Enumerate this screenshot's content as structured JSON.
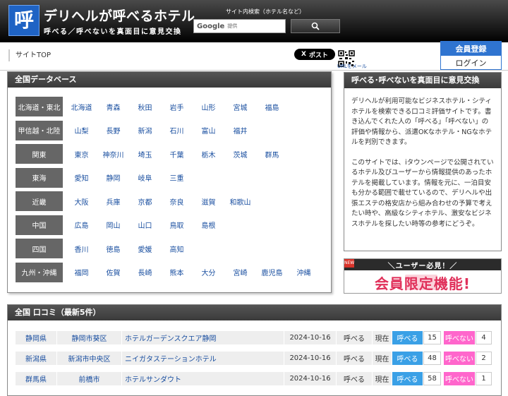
{
  "header": {
    "logo_char": "呼",
    "title": "デリヘルが呼べるホテル",
    "subtitle": "呼べる／呼べないを真面目に意見交換",
    "search_caption": "サイト内検索（ホテル名など）",
    "search_brand": "Google",
    "search_provided": "提供",
    "search_button_icon": "search-icon"
  },
  "subbar": {
    "breadcrumb": "サイトTOP",
    "post_label": "ポスト",
    "post_prefix": "X",
    "url_link": "URLをメール",
    "register_label": "会員登録",
    "login_label": "ログイン"
  },
  "database": {
    "title": "全国データベース",
    "regions": [
      {
        "label": "北海道・東北",
        "prefs": [
          "北海道",
          "青森",
          "秋田",
          "岩手",
          "山形",
          "宮城",
          "福島"
        ]
      },
      {
        "label": "甲信越・北陸",
        "prefs": [
          "山梨",
          "長野",
          "新潟",
          "石川",
          "富山",
          "福井"
        ]
      },
      {
        "label": "関東",
        "prefs": [
          "東京",
          "神奈川",
          "埼玉",
          "千葉",
          "栃木",
          "茨城",
          "群馬"
        ]
      },
      {
        "label": "東海",
        "prefs": [
          "愛知",
          "静岡",
          "岐阜",
          "三重"
        ]
      },
      {
        "label": "近畿",
        "prefs": [
          "大阪",
          "兵庫",
          "京都",
          "奈良",
          "滋賀",
          "和歌山"
        ]
      },
      {
        "label": "中国",
        "prefs": [
          "広島",
          "岡山",
          "山口",
          "鳥取",
          "島根"
        ]
      },
      {
        "label": "四国",
        "prefs": [
          "香川",
          "徳島",
          "愛媛",
          "高知"
        ]
      },
      {
        "label": "九州・沖縄",
        "prefs": [
          "福岡",
          "佐賀",
          "長崎",
          "熊本",
          "大分",
          "宮崎",
          "鹿児島",
          "沖縄"
        ]
      }
    ]
  },
  "info": {
    "title": "呼べる･呼べないを真面目に意見交換",
    "paragraph1": "デリヘルが利用可能なビジネスホテル・シティホテルを検索できる口コミ評価サイトです。書き込んでくれた人の「呼べる」「呼べない」の評価や情報から、派遣OKなホテル・NGなホテルを判別できます。",
    "paragraph2": "このサイトでは、iタウンページで公開されているホテル及びユーザーから情報提供のあったホテルを掲載しています。情報を元に、一泊目安も分かる範囲で載せているので、デリヘルや出張エステの格安店から組み合わせの予算で考えたい時や、高級なシティホテル、激安なビジネスホテルを探したい時等の参考にどうぞ。"
  },
  "banner": {
    "badge": "NEW",
    "top_text": "ユーザー必見！",
    "main_text": "会員限定機能!"
  },
  "reviews": {
    "title": "全国 口コミ（最新5件）",
    "now_label": "現在",
    "yobu_label": "呼べる",
    "yobenai_label": "呼べない",
    "rows": [
      {
        "pref": "静岡県",
        "city": "静岡市葵区",
        "hotel": "ホテルガーデンスクエア静岡",
        "date": "2024-10-16",
        "result": "呼べる",
        "yobu": "15",
        "yobenai": "4"
      },
      {
        "pref": "新潟県",
        "city": "新潟市中央区",
        "hotel": "ニイガタステーションホテル",
        "date": "2024-10-16",
        "result": "呼べる",
        "yobu": "48",
        "yobenai": "2"
      },
      {
        "pref": "群馬県",
        "city": "前橋市",
        "hotel": "ホテルサンダウト",
        "date": "2024-10-16",
        "result": "呼べる",
        "yobu": "58",
        "yobenai": "1"
      }
    ]
  },
  "colors": {
    "header_bg": "#1e1e1e",
    "logo_blue": "#1f63c4",
    "register_blue": "#2f74d0",
    "link": "#1a4fa0",
    "region_bg": "#666666",
    "yobu_blue": "#3aa0e6",
    "yobenai_pink": "#ff66cc",
    "banner_pink": "#e0305a"
  }
}
